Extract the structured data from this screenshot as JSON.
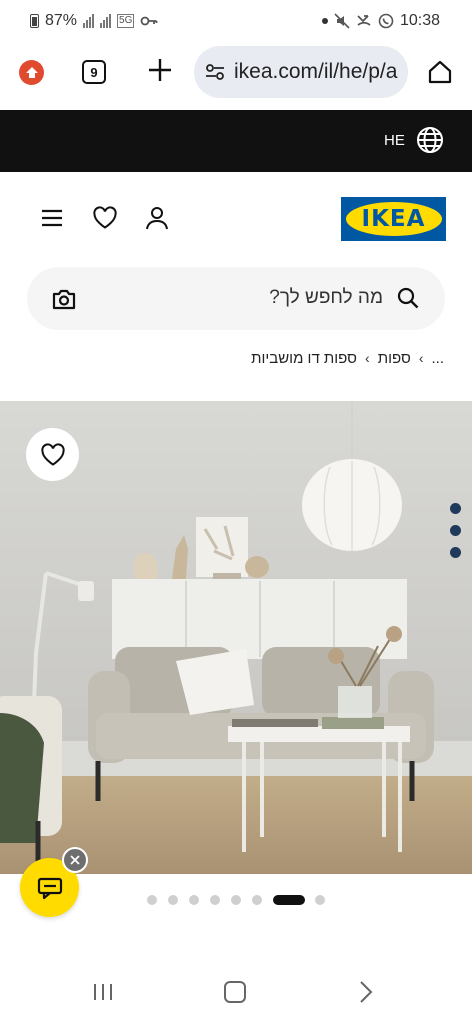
{
  "status_bar": {
    "battery": "87%",
    "network": "5G",
    "time": "10:38"
  },
  "browser": {
    "tab_count": "9",
    "url": "ikea.com/il/he/p/a"
  },
  "locale": {
    "language_code": "HE"
  },
  "header": {
    "logo_text": "IKEA"
  },
  "search": {
    "placeholder": "מה לחפש לך?"
  },
  "breadcrumb": {
    "items": [
      "...",
      "ספות",
      "ספות דו מושביות"
    ]
  },
  "gallery": {
    "total_images": 8,
    "active_index": 6
  },
  "colors": {
    "ikea_blue": "#0058a3",
    "ikea_yellow": "#ffdb00",
    "locale_bar": "#111111"
  }
}
